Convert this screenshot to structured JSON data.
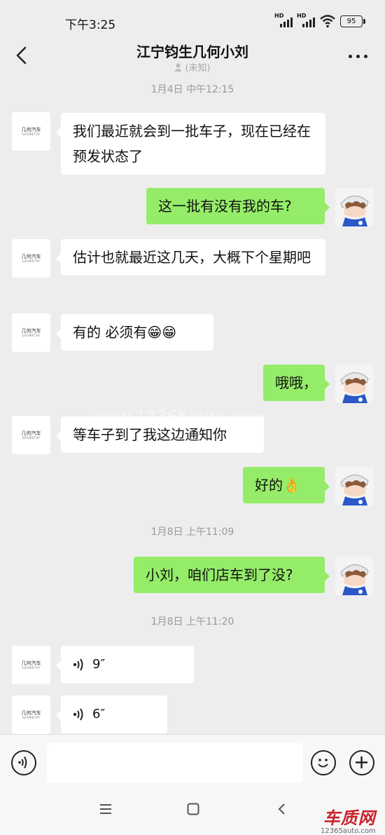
{
  "status": {
    "time": "下午3:25",
    "hd1": "HD",
    "hd2": "HD",
    "battery": "95",
    "wifi_icon": "wifi-icon"
  },
  "header": {
    "title": "江宁钧生几何小刘",
    "subtitle": "(未知)",
    "back_icon": "back-icon",
    "more_icon": "more-icon"
  },
  "contact_logo": {
    "cn": "几何汽车",
    "en": "GEOMETRY"
  },
  "timestamps": [
    "1月4日 中午12:15",
    "1月8日 上午11:09",
    "1月8日 上午11:20"
  ],
  "messages": [
    {
      "side": "in",
      "text": "我们最近就会到一批车子，现在已经在预发状态了"
    },
    {
      "side": "out",
      "text": "这一批有没有我的车?"
    },
    {
      "side": "in",
      "text": "估计也就最近这几天，大概下个星期吧"
    },
    {
      "side": "in",
      "text": "有的 必须有😁😁"
    },
    {
      "side": "out",
      "text": "哦哦，"
    },
    {
      "side": "in",
      "text": "等车子到了我这边通知你"
    },
    {
      "side": "out",
      "text": "好的👌"
    },
    {
      "side": "out",
      "text": "小刘，咱们店车到了没?"
    },
    {
      "side": "in",
      "type": "voice",
      "text": "9″"
    },
    {
      "side": "in",
      "type": "voice",
      "text": "6″"
    }
  ],
  "watermark": "www.12365auto.com",
  "input": {
    "voice_icon": "voice-toggle-icon",
    "emoji_icon": "emoji-icon",
    "plus_icon": "plus-icon"
  },
  "navbar": [
    "menu-icon",
    "home-icon",
    "back-nav-icon"
  ],
  "brand": {
    "cn": "车质网",
    "en": "12365auto.com"
  },
  "colors": {
    "background": "#ededed",
    "bubble_out": "#95ec69",
    "bubble_in": "#ffffff",
    "brand_red": "#c9232b"
  }
}
